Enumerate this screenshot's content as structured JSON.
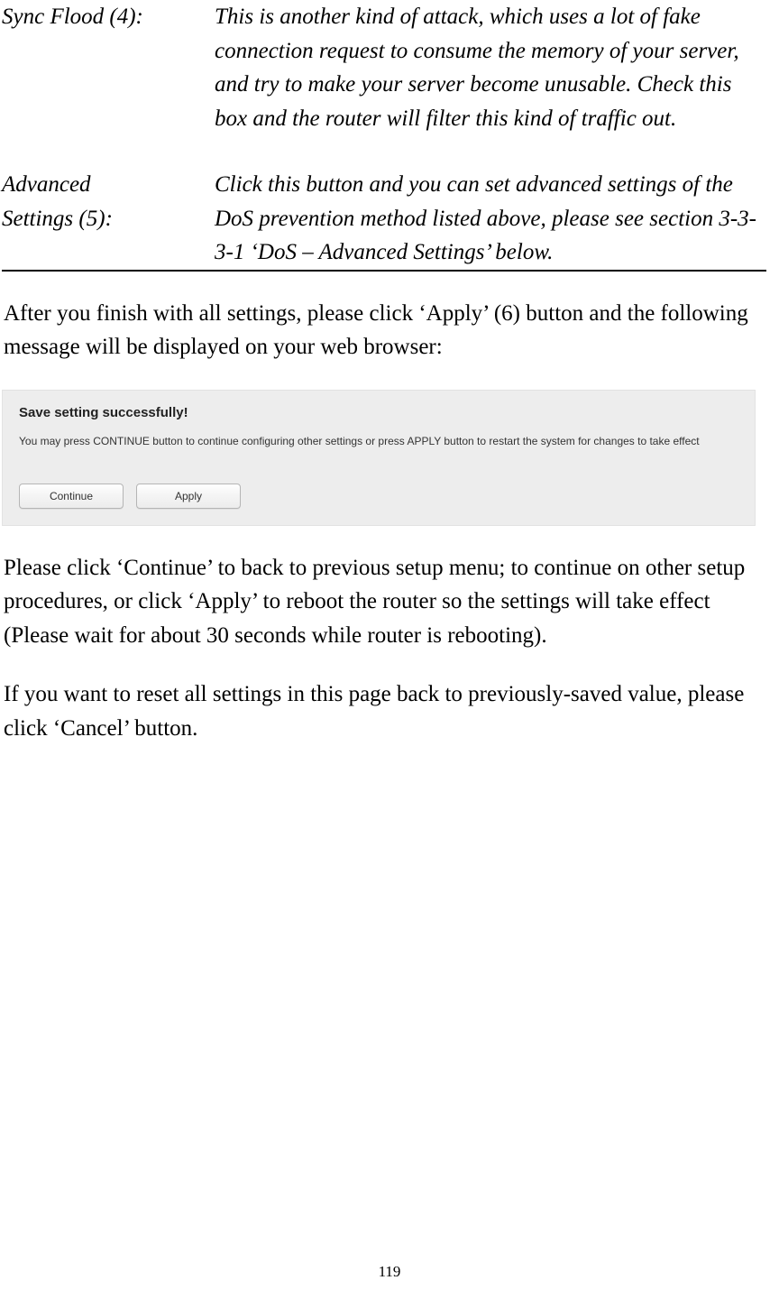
{
  "definitions": {
    "row1": {
      "term": "Sync Flood (4):",
      "desc": "This is another kind of attack, which uses a lot of fake connection request to consume the memory of your server, and try to make your server become unusable. Check this box and the router will filter this kind of traffic out."
    },
    "row2": {
      "term_line1": "Advanced",
      "term_line2": "Settings (5):",
      "desc": "Click this button and you can set advanced settings of the DoS prevention method listed above, please see section 3-3-3-1 ‘DoS – Advanced Settings’ below."
    }
  },
  "paragraphs": {
    "p1": "After you finish with all settings, please click ‘Apply’ (6) button and the following message will be displayed on your web browser:",
    "p2": "Please click ‘Continue’ to back to previous setup menu; to continue on other setup procedures, or click ‘Apply’ to reboot the router so the settings will take effect (Please wait for about 30 seconds while router is rebooting).",
    "p3": "If you want to reset all settings in this page back to previously-saved value, please click ‘Cancel’ button."
  },
  "screenshot": {
    "title": "Save setting successfully!",
    "subtext": "You may press CONTINUE button to continue configuring other settings or press APPLY button to restart the system for changes to take effect",
    "continue_label": "Continue",
    "apply_label": "Apply"
  },
  "page_number": "119"
}
